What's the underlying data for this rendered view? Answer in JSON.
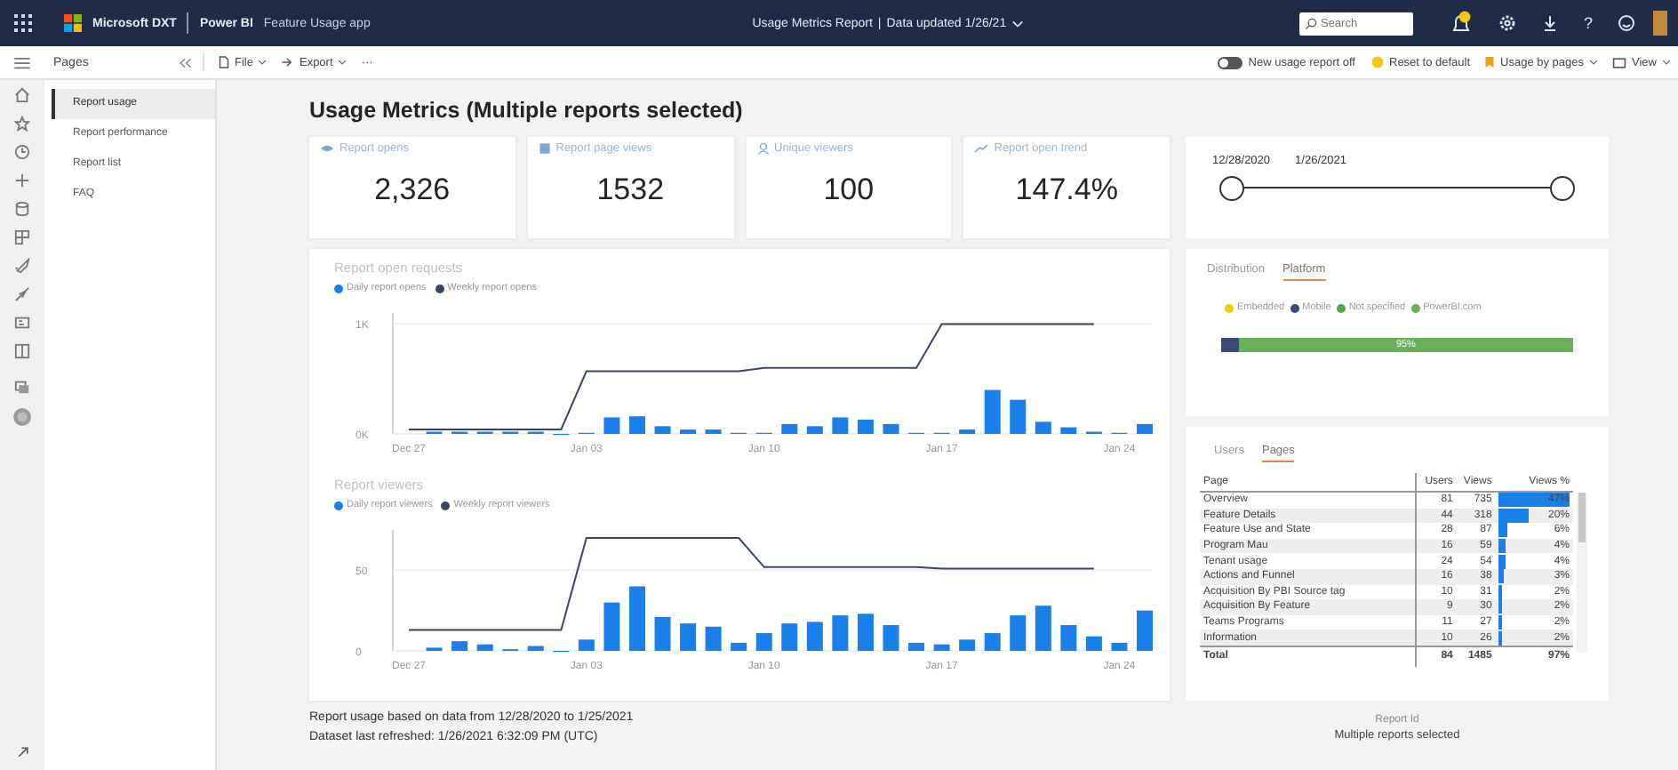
{
  "topbar": {
    "org": "Microsoft DXT",
    "product": "Power BI",
    "app": "Feature Usage app",
    "report_title": "Usage Metrics Report",
    "separator": "|",
    "updated": "Data updated 1/26/21",
    "search": {
      "placeholder": "Search"
    },
    "help": "?"
  },
  "toolbar": {
    "pages_label": "Pages",
    "file": "File",
    "export": "Export",
    "more": "···",
    "toggle": {
      "label": "New usage report off",
      "on": false
    },
    "reset": "Reset to default",
    "bookmark": "Usage by pages",
    "view": "View"
  },
  "pages": [
    {
      "label": "Report usage",
      "selected": true
    },
    {
      "label": "Report performance",
      "selected": false
    },
    {
      "label": "Report list",
      "selected": false
    },
    {
      "label": "FAQ",
      "selected": false
    }
  ],
  "title": "Usage Metrics (Multiple reports selected)",
  "kpis": [
    {
      "kind": "eye",
      "label": "Report opens",
      "value": "2,326"
    },
    {
      "kind": "page",
      "label": "Report page views",
      "value": "1532"
    },
    {
      "kind": "person",
      "label": "Unique viewers",
      "value": "100"
    },
    {
      "kind": "trend",
      "label": "Report open trend",
      "value": "147.4%"
    }
  ],
  "charts": [
    {
      "chart_data": {
        "type": "bar",
        "title": "Report open requests",
        "categories": [
          "Dec 27",
          null,
          null,
          null,
          null,
          null,
          null,
          "Jan 03",
          null,
          null,
          null,
          null,
          null,
          null,
          "Jan 10",
          null,
          null,
          null,
          null,
          null,
          null,
          "Jan 17",
          null,
          null,
          null,
          null,
          null,
          null,
          "Jan 24",
          null
        ],
        "yticks": [
          {
            "value": 0,
            "label": "0K"
          },
          {
            "value": 1000,
            "label": "1K"
          }
        ],
        "ylim": [
          0,
          1100
        ],
        "legend": "top-left",
        "series": [
          {
            "name": "Daily report opens",
            "type": "bar",
            "color": "#1a7fe8",
            "values": [
              null,
              20,
              20,
              20,
              20,
              20,
              0,
              10,
              150,
              160,
              70,
              40,
              40,
              10,
              10,
              90,
              70,
              150,
              130,
              90,
              10,
              10,
              40,
              400,
              310,
              110,
              60,
              20,
              10,
              90
            ]
          },
          {
            "name": "Weekly report opens",
            "type": "line",
            "color": "#3a4566",
            "values": [
              40,
              40,
              40,
              40,
              40,
              40,
              40,
              570,
              570,
              570,
              570,
              570,
              570,
              570,
              600,
              600,
              600,
              600,
              600,
              600,
              600,
              1000,
              1000,
              1000,
              1000,
              1000,
              1000,
              1000,
              null,
              null
            ]
          }
        ]
      }
    },
    {
      "chart_data": {
        "type": "bar",
        "title": "Report viewers",
        "categories": [
          "Dec 27",
          null,
          null,
          null,
          null,
          null,
          null,
          "Jan 03",
          null,
          null,
          null,
          null,
          null,
          null,
          "Jan 10",
          null,
          null,
          null,
          null,
          null,
          null,
          "Jan 17",
          null,
          null,
          null,
          null,
          null,
          null,
          "Jan 24",
          null
        ],
        "yticks": [
          {
            "value": 0,
            "label": "0"
          },
          {
            "value": 50,
            "label": "50"
          }
        ],
        "ylim": [
          0,
          75
        ],
        "legend": "top-left",
        "series": [
          {
            "name": "Daily report viewers",
            "type": "bar",
            "color": "#1a7fe8",
            "values": [
              null,
              2,
              6,
              4,
              1,
              3,
              0,
              7,
              30,
              40,
              21,
              17,
              15,
              5,
              11,
              17,
              18,
              22,
              23,
              16,
              5,
              4,
              7,
              11,
              22,
              28,
              16,
              9,
              5,
              25
            ]
          },
          {
            "name": "Weekly report viewers",
            "type": "line",
            "color": "#3a4566",
            "values": [
              13,
              13,
              13,
              13,
              13,
              13,
              13,
              70,
              70,
              70,
              70,
              70,
              70,
              70,
              52,
              52,
              52,
              52,
              52,
              52,
              52,
              51,
              51,
              51,
              51,
              51,
              51,
              51,
              null,
              null
            ]
          }
        ]
      }
    }
  ],
  "footer": [
    "Report usage based on data from 12/28/2020 to 1/25/2021",
    "Dataset last refreshed: 1/26/2021 6:32:09 PM (UTC)"
  ],
  "date_slicer": {
    "start": "12/28/2020",
    "end": "1/26/2021",
    "handles": [
      {
        "level": 0
      },
      {
        "level": 1
      }
    ]
  },
  "platform_card": {
    "tabs": [
      {
        "label": "Distribution",
        "selected": false
      },
      {
        "label": "Platform",
        "selected": true
      }
    ],
    "legend": [
      {
        "label": "Embedded",
        "color": "#f2c811"
      },
      {
        "label": "Mobile",
        "color": "#3b4a7a"
      },
      {
        "label": "Not specified",
        "color": "#55a84f"
      },
      {
        "label": "PowerBI.com",
        "color": "#6aae5c"
      }
    ],
    "stacked_bar": {
      "color": "#6aae5c",
      "label": "95%",
      "segments": [
        {
          "color": "#3b4a7a",
          "level": 0.05
        }
      ]
    }
  },
  "pages_card": {
    "tabs": [
      {
        "label": "Users",
        "selected": false
      },
      {
        "label": "Pages",
        "selected": true
      }
    ],
    "columns": [
      "Page",
      "Users",
      "Views",
      "Views %"
    ],
    "rows": [
      {
        "page": "Overview",
        "users": "81",
        "views": "735",
        "pct": "47%",
        "level": 1
      },
      {
        "page": "Feature Details",
        "users": "44",
        "views": "318",
        "pct": "20%",
        "level": 0.43
      },
      {
        "page": "Feature Use and State",
        "users": "28",
        "views": "87",
        "pct": "6%",
        "level": 0.13
      },
      {
        "page": "Program Mau",
        "users": "16",
        "views": "59",
        "pct": "4%",
        "level": 0.09
      },
      {
        "page": "Tenant usage",
        "users": "24",
        "views": "54",
        "pct": "4%",
        "level": 0.09
      },
      {
        "page": "Actions and Funnel",
        "users": "16",
        "views": "38",
        "pct": "3%",
        "level": 0.06
      },
      {
        "page": "Acquisition By PBI Source tag",
        "users": "10",
        "views": "31",
        "pct": "2%",
        "level": 0.04
      },
      {
        "page": "Acquisition By Feature",
        "users": "9",
        "views": "30",
        "pct": "2%",
        "level": 0.04
      },
      {
        "page": "Teams Programs",
        "users": "11",
        "views": "27",
        "pct": "2%",
        "level": 0.04
      },
      {
        "page": "Information",
        "users": "10",
        "views": "26",
        "pct": "2%",
        "level": 0.04
      }
    ],
    "total": {
      "page": "Total",
      "users": "84",
      "views": "1485",
      "pct": "97%"
    }
  },
  "report_id": {
    "label": "Report Id",
    "value": "Multiple reports selected"
  }
}
